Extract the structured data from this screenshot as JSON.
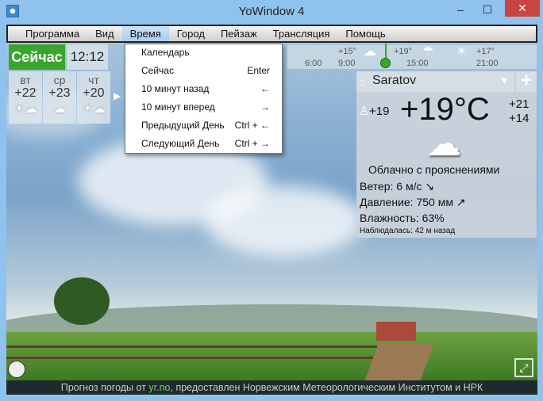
{
  "window": {
    "title": "YoWindow 4",
    "minimize": "‒",
    "maximize": "☐",
    "close": "✕"
  },
  "menubar": [
    "Программа",
    "Вид",
    "Время",
    "Город",
    "Пейзаж",
    "Трансляция",
    "Помощь"
  ],
  "now_button": "Сейчас",
  "clock": "12:12",
  "days": [
    {
      "name": "вт",
      "temp": "+22",
      "icon": "☀☁"
    },
    {
      "name": "ср",
      "temp": "+23",
      "icon": "☁"
    },
    {
      "name": "чт",
      "temp": "+20",
      "icon": "☀☁"
    }
  ],
  "days_next": "▶",
  "timeline": {
    "temps": [
      "+15°",
      "+19°",
      "+17°"
    ],
    "times": [
      "6:00",
      "9:00",
      "15:00",
      "21:00"
    ],
    "icons": [
      "☁",
      "☂",
      "☀"
    ]
  },
  "time_menu": [
    {
      "label": "Календарь",
      "shortcut": ""
    },
    {
      "label": "Сейчас",
      "shortcut": "Enter"
    },
    {
      "label": "10 минут назад",
      "shortcut": "←"
    },
    {
      "label": "10 минут вперед",
      "shortcut": "→"
    },
    {
      "label": "Предыдущий День",
      "shortcut": "Ctrl + ←"
    },
    {
      "label": "Следующий День",
      "shortcut": "Ctrl + →"
    }
  ],
  "weather": {
    "city": "Saratov",
    "feels_like": "+19",
    "temp": "+19°C",
    "high": "+21",
    "low": "+14",
    "icon": "☁",
    "description": "Облачно с прояснениями",
    "wind": "Ветер:  6 м/с ↘",
    "pressure": "Давление:  750 мм ↗",
    "humidity": "Влажность:  63%",
    "observed": "Наблюдалась:  42 м назад"
  },
  "footer": {
    "pre": "Прогноз погоды от ",
    "link": "yr.no",
    "post": ", предоставлен Норвежским Метеорологическим Институтом и НРК"
  }
}
